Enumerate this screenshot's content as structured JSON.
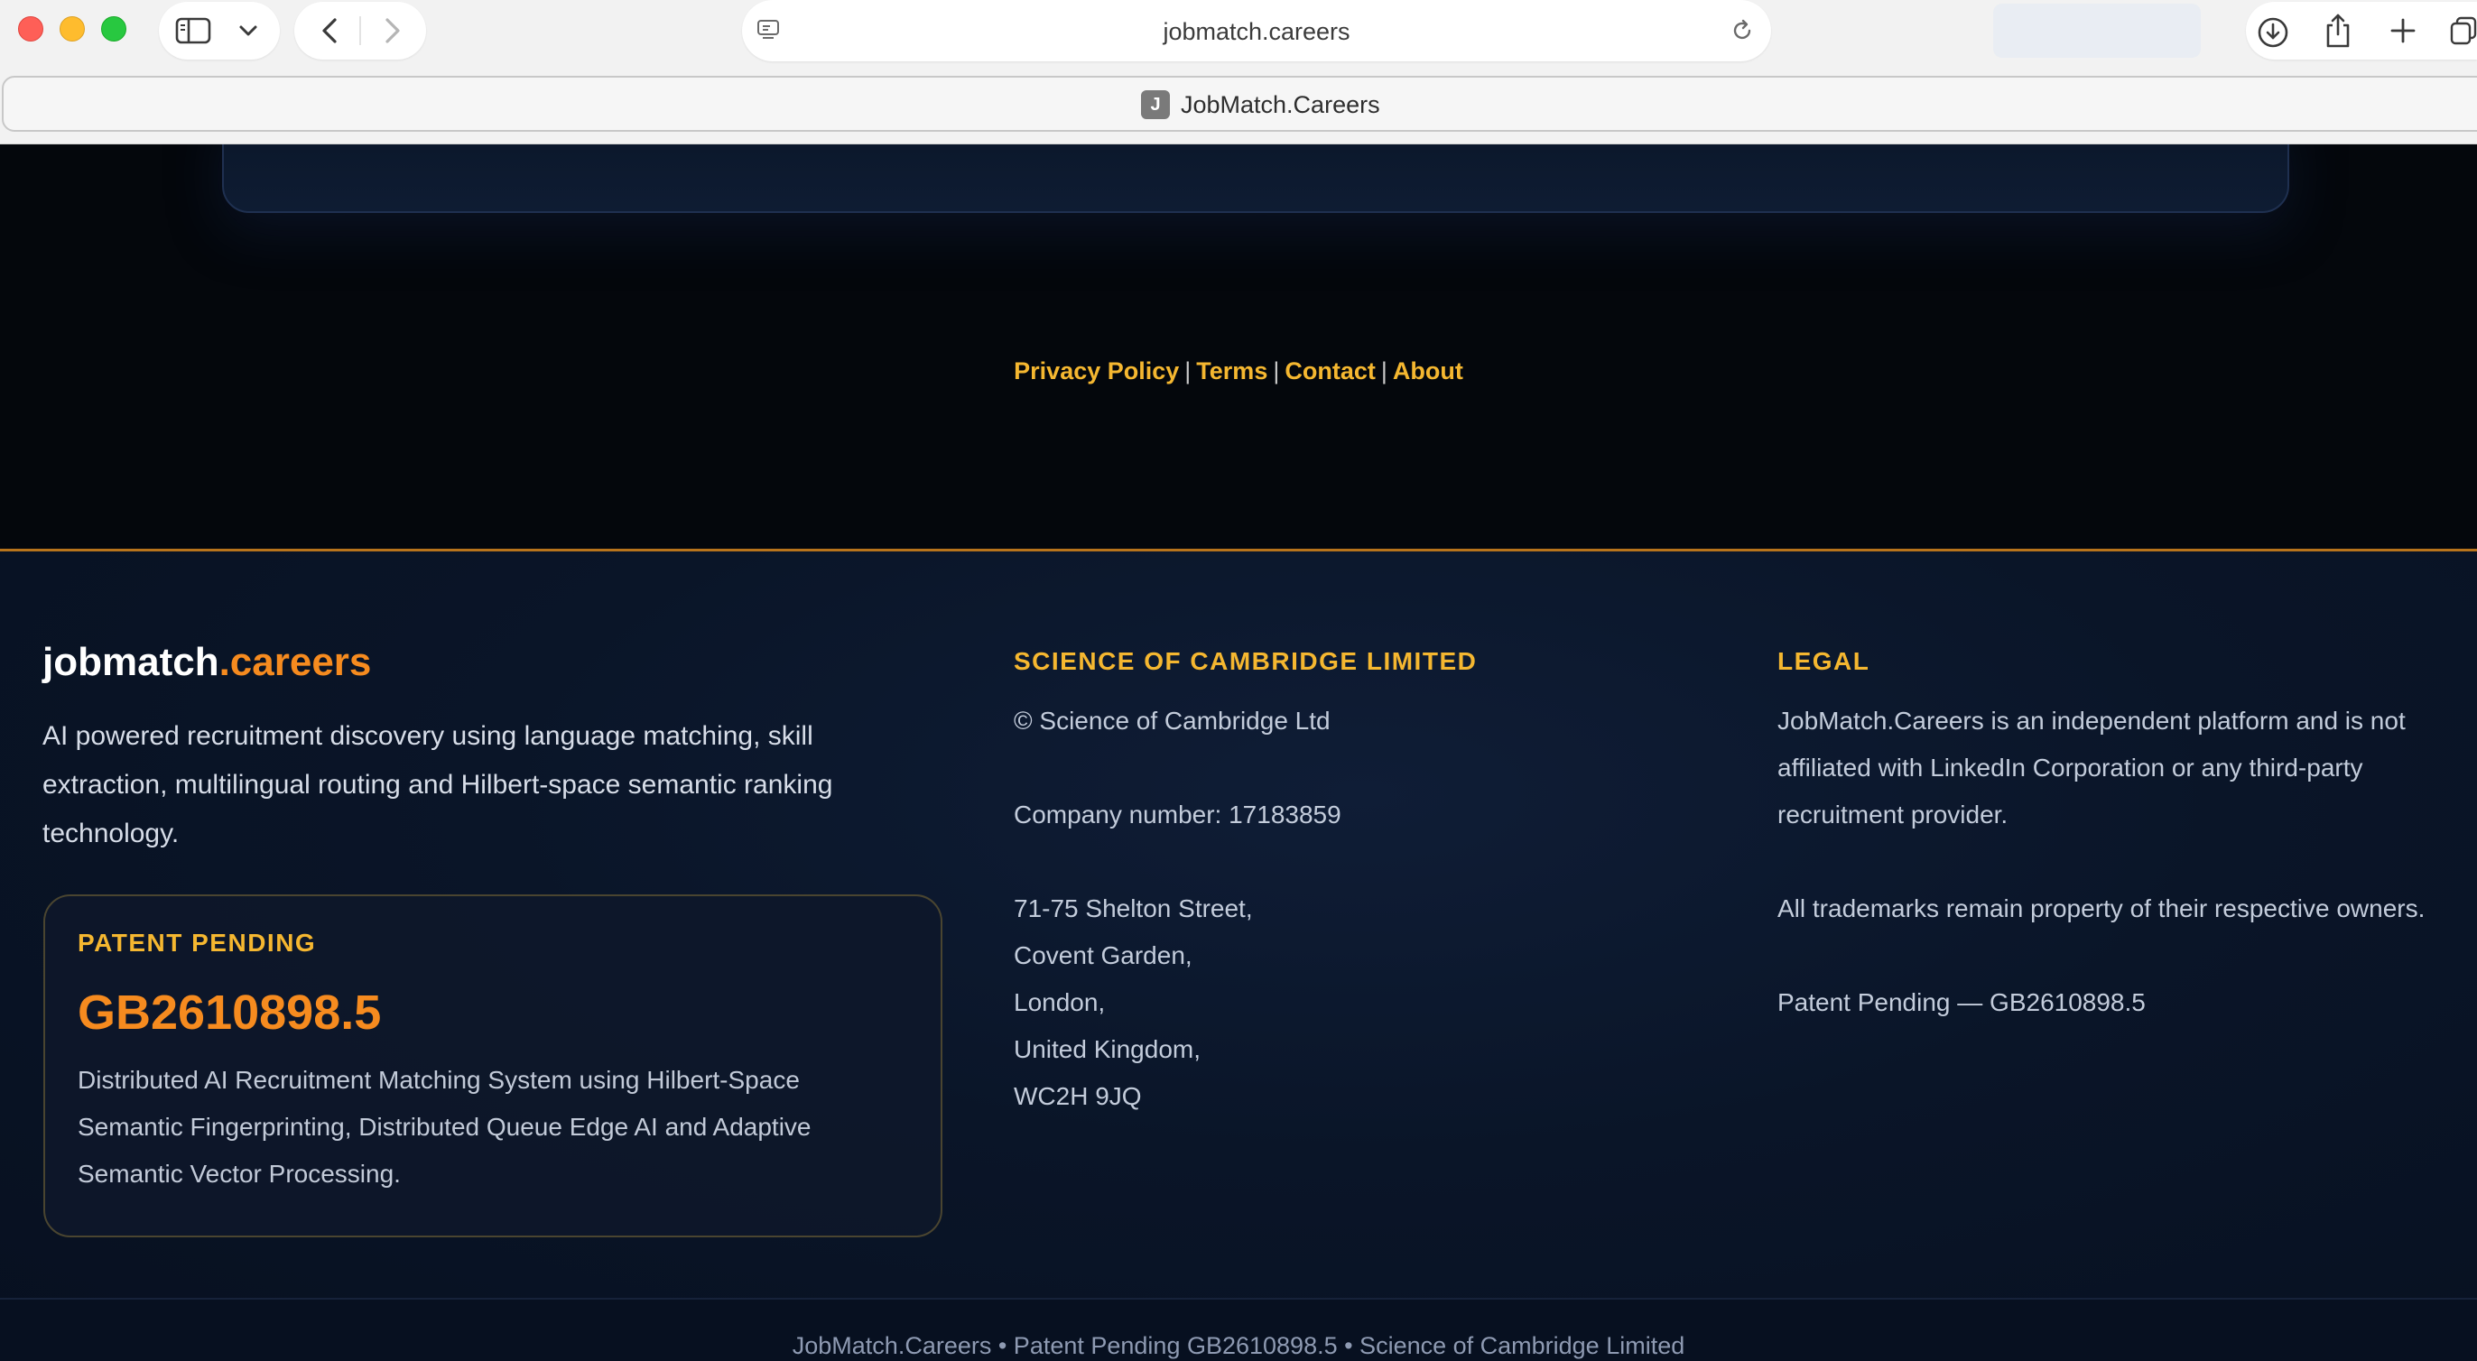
{
  "browser": {
    "url": "jobmatch.careers",
    "tab_title": "JobMatch.Careers",
    "tab_favicon_letter": "J"
  },
  "icons": [
    "sidebar-icon",
    "chevron-down-icon",
    "back-icon",
    "forward-icon",
    "reader-icon",
    "reload-icon",
    "download-icon",
    "share-icon",
    "new-tab-icon",
    "tab-overview-icon"
  ],
  "nav_links": [
    {
      "label": "Privacy Policy"
    },
    {
      "label": "Terms"
    },
    {
      "label": "Contact"
    },
    {
      "label": "About"
    }
  ],
  "nav_separator": "|",
  "footer": {
    "brand": {
      "part1": "jobmatch",
      "part2": ".careers"
    },
    "description": "AI powered recruitment discovery using language matching, skill extraction, multilingual routing and Hilbert-space semantic ranking technology.",
    "patent": {
      "label": "PATENT PENDING",
      "number": "GB2610898.5",
      "description": "Distributed AI Recruitment Matching System using Hilbert-Space Semantic Fingerprinting, Distributed Queue Edge AI and Adaptive Semantic Vector Processing."
    },
    "company": {
      "heading": "SCIENCE OF CAMBRIDGE LIMITED",
      "copyright": "© Science of Cambridge Ltd",
      "company_number": "Company number: 17183859",
      "address": [
        "71-75 Shelton Street,",
        "Covent Garden,",
        "London,",
        "United Kingdom,",
        "WC2H 9JQ"
      ]
    },
    "legal": {
      "heading": "LEGAL",
      "disclaimer": "JobMatch.Careers is an independent platform and is not affiliated with LinkedIn Corporation or any third-party recruitment provider.",
      "trademarks": "All trademarks remain property of their respective owners.",
      "patent_line": "Patent Pending — GB2610898.5"
    },
    "bottom_line": "JobMatch.Careers • Patent Pending GB2610898.5 • Science of Cambridge Limited"
  },
  "colors": {
    "accent_orange": "#f68b1f",
    "accent_gold": "#f5b730",
    "background": "#05080e",
    "footer_border": "#b8741c"
  }
}
